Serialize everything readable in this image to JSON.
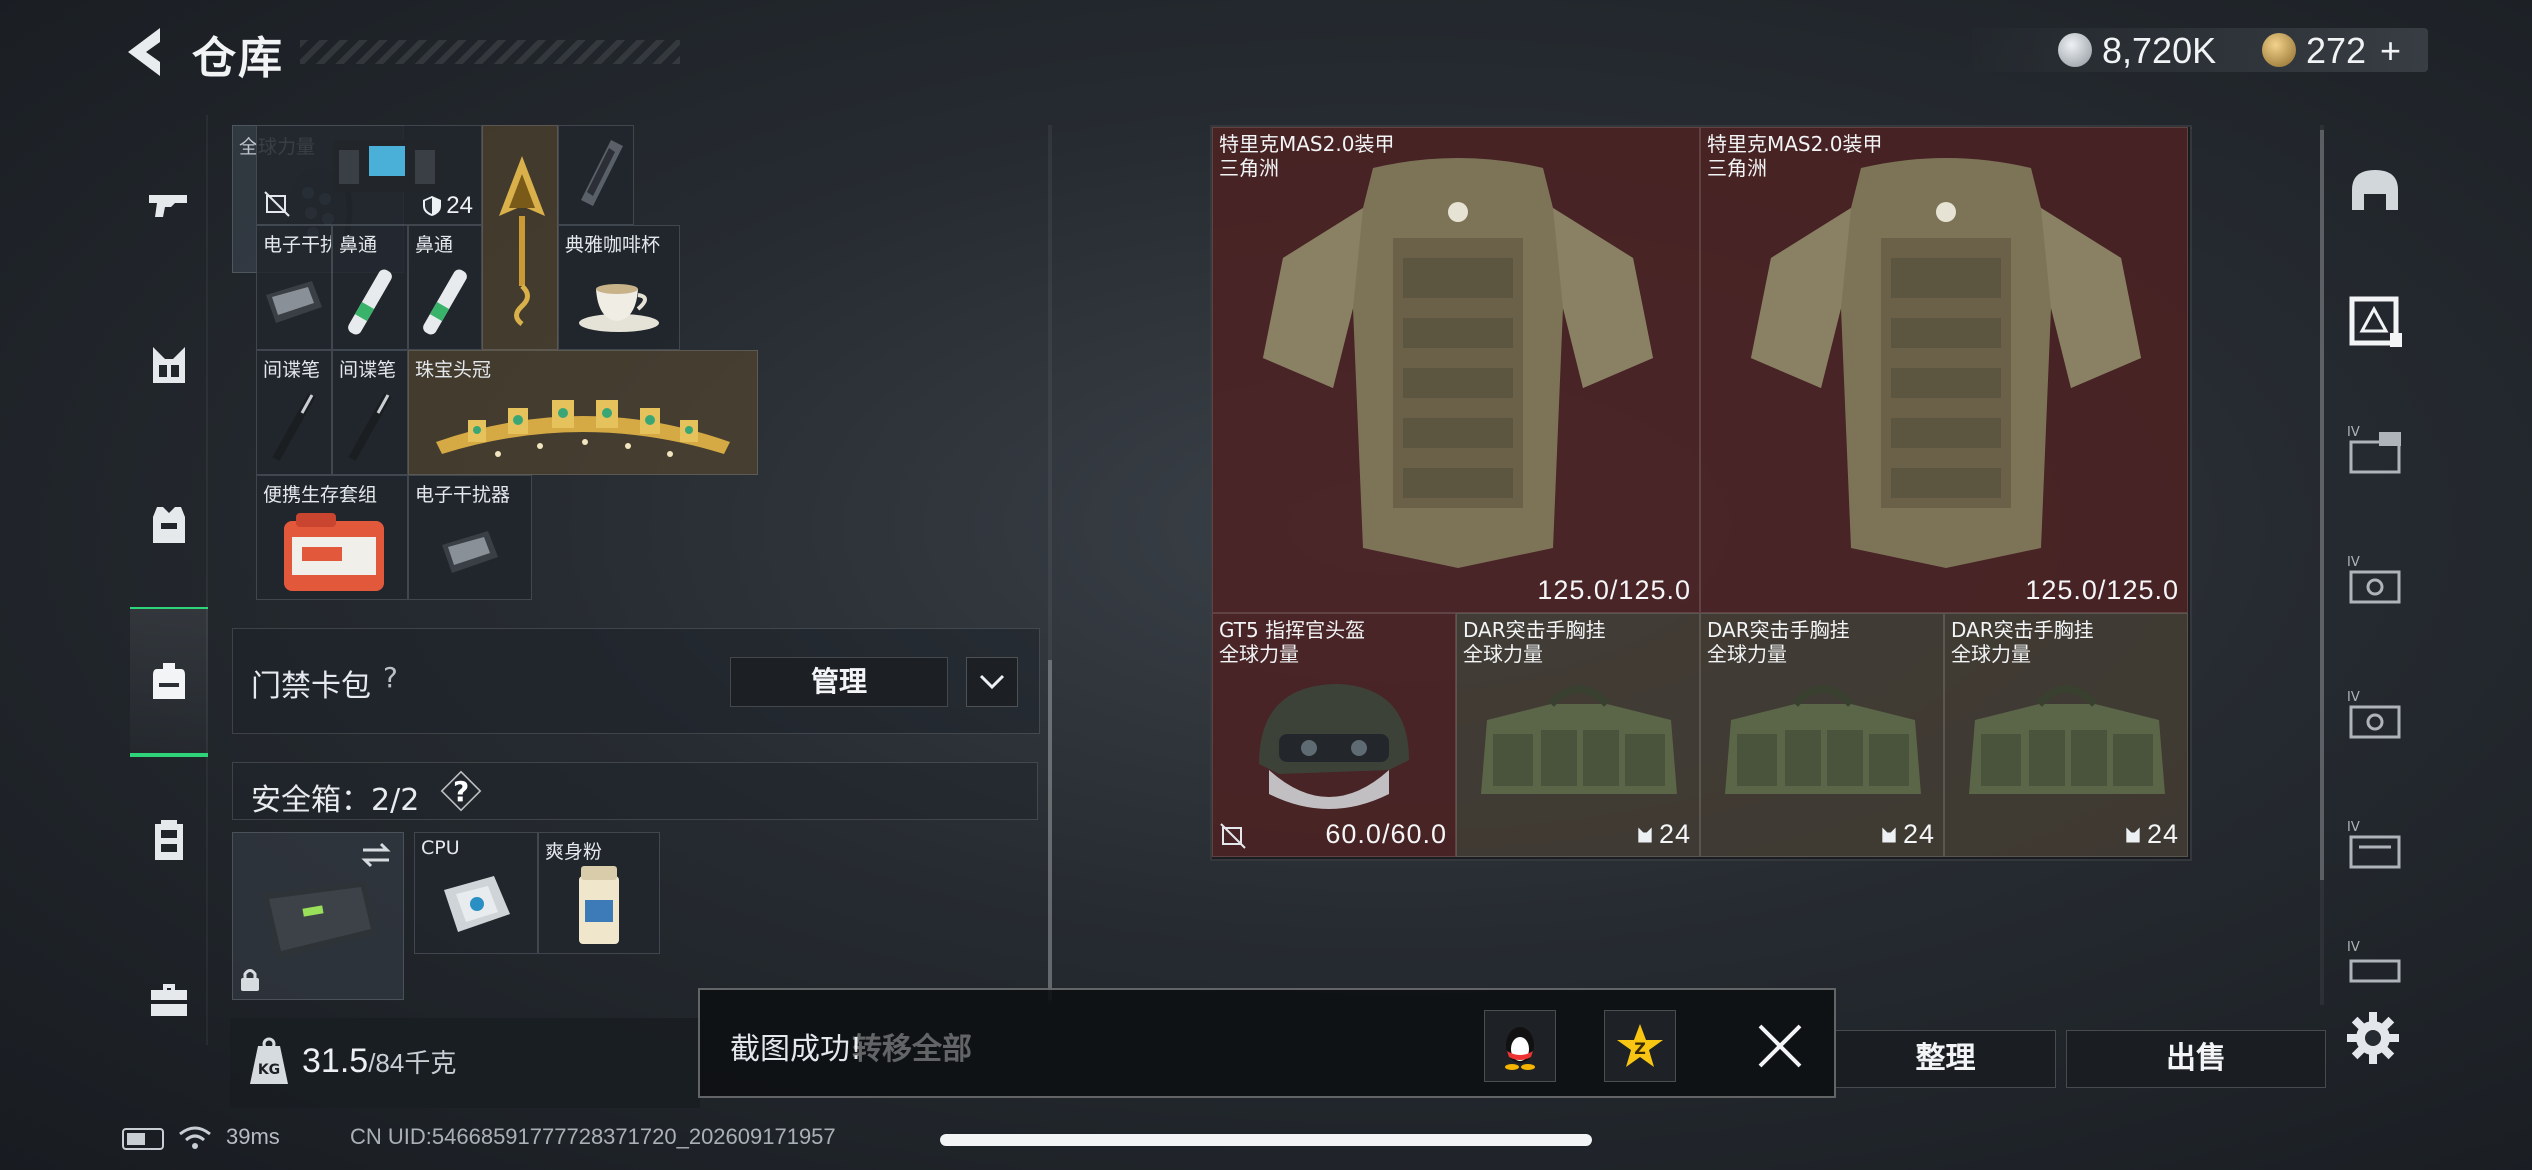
{
  "header": {
    "title": "仓库",
    "currency_1": "8,720K",
    "currency_2": "272",
    "currency_2_plus": "+",
    "colors": {
      "silver_coin": "#c7ccd1",
      "gold_coin": "#c9a55c"
    }
  },
  "left_nav": {
    "items": [
      {
        "icon": "gun-icon"
      },
      {
        "icon": "chest-rig-icon"
      },
      {
        "icon": "armor-icon"
      },
      {
        "icon": "backpack-icon",
        "active": true
      },
      {
        "icon": "vest-icon"
      },
      {
        "icon": "briefcase-icon"
      }
    ],
    "accent_color": "#2fd37a"
  },
  "backpack": {
    "top_item_label_1": "全球力量",
    "cells": {
      "jammer_top_durability": "24",
      "jammer_1": "电子干扰器",
      "nasal_1": "鼻通",
      "nasal_2": "鼻通",
      "coffee_cup": "典雅咖啡杯",
      "spy_pen_1": "间谍笔",
      "spy_pen_2": "间谍笔",
      "tiara": "珠宝头冠",
      "survival_kit": "便携生存套组",
      "jammer_2": "电子干扰器"
    }
  },
  "keycard": {
    "label": "门禁卡包",
    "help": "?",
    "manage_label": "管理"
  },
  "safebox": {
    "label": "安全箱：2/2",
    "help": "?",
    "cells": {
      "cpu": "CPU",
      "powder": "爽身粉"
    }
  },
  "weight": {
    "icon_text": "KG",
    "current": "31.5",
    "max": "/84",
    "unit": "千克"
  },
  "stash": {
    "armor_1": {
      "name": "特里克MAS2.0装甲",
      "faction": "三角洲",
      "durability": "125.0/125.0"
    },
    "armor_2": {
      "name": "特里克MAS2.0装甲",
      "faction": "三角洲",
      "durability": "125.0/125.0"
    },
    "helmet": {
      "name": "GT5 指挥官头盔",
      "faction": "全球力量",
      "durability": "60.0/60.0"
    },
    "rig_1": {
      "name": "DAR突击手胸挂",
      "faction": "全球力量",
      "capacity": "24"
    },
    "rig_2": {
      "name": "DAR突击手胸挂",
      "faction": "全球力量",
      "capacity": "24"
    },
    "rig_3": {
      "name": "DAR突击手胸挂",
      "faction": "全球力量",
      "capacity": "24"
    }
  },
  "right_nav": {
    "items": [
      {
        "icon": "helmet-slot-icon"
      },
      {
        "icon": "armor-slot-icon",
        "active": true
      },
      {
        "icon": "tier-iv-case-icon"
      },
      {
        "icon": "tier-iv-case-icon"
      },
      {
        "icon": "tier-iv-case-icon"
      },
      {
        "icon": "tier-iv-case-icon"
      },
      {
        "icon": "tier-iv-case-icon"
      }
    ],
    "tier_label": "IV"
  },
  "actions": {
    "transfer_all": "转移全部",
    "organize": "整理",
    "sell": "出售"
  },
  "toast": {
    "message": "截图成功!"
  },
  "status": {
    "ping": "39ms",
    "uid": "CN UID:5466859177772837172​0_202609171957"
  }
}
